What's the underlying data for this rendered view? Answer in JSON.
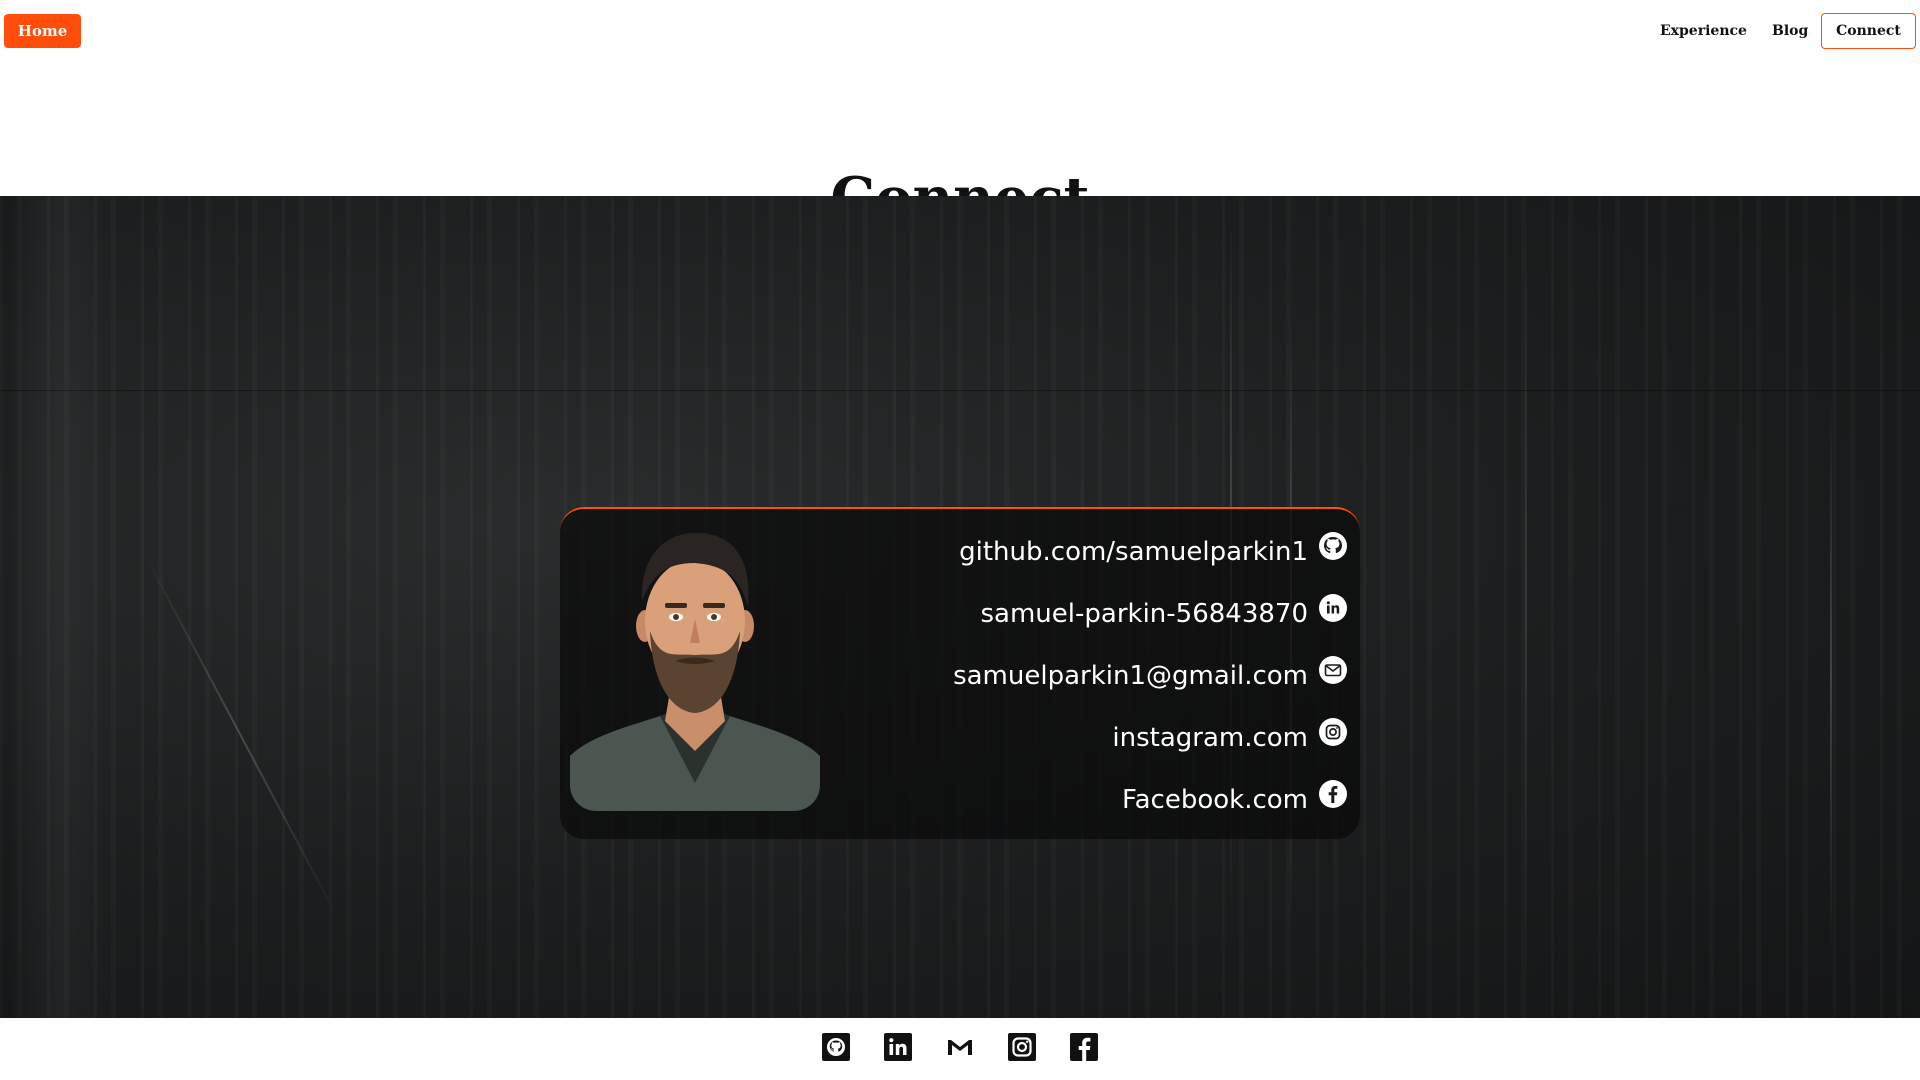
{
  "nav": {
    "home_label": "Home",
    "experience_label": "Experience",
    "blog_label": "Blog",
    "connect_label": "Connect"
  },
  "section": {
    "heading": "Connect"
  },
  "contact": {
    "links": [
      {
        "text": "github.com/samuelparkin1",
        "icon": "github-icon"
      },
      {
        "text": "samuel-parkin-56843870",
        "icon": "linkedin-icon"
      },
      {
        "text": "samuelparkin1@gmail.com",
        "icon": "mail-icon"
      },
      {
        "text": "instagram.com",
        "icon": "instagram-icon"
      },
      {
        "text": "Facebook.com",
        "icon": "facebook-icon"
      }
    ]
  },
  "footer": {
    "icons": [
      "github-icon",
      "linkedin-icon",
      "gmail-icon",
      "instagram-icon",
      "facebook-icon"
    ]
  },
  "colors": {
    "accent": "#ff4d0b",
    "dark_bg": "#1c1e1f"
  }
}
